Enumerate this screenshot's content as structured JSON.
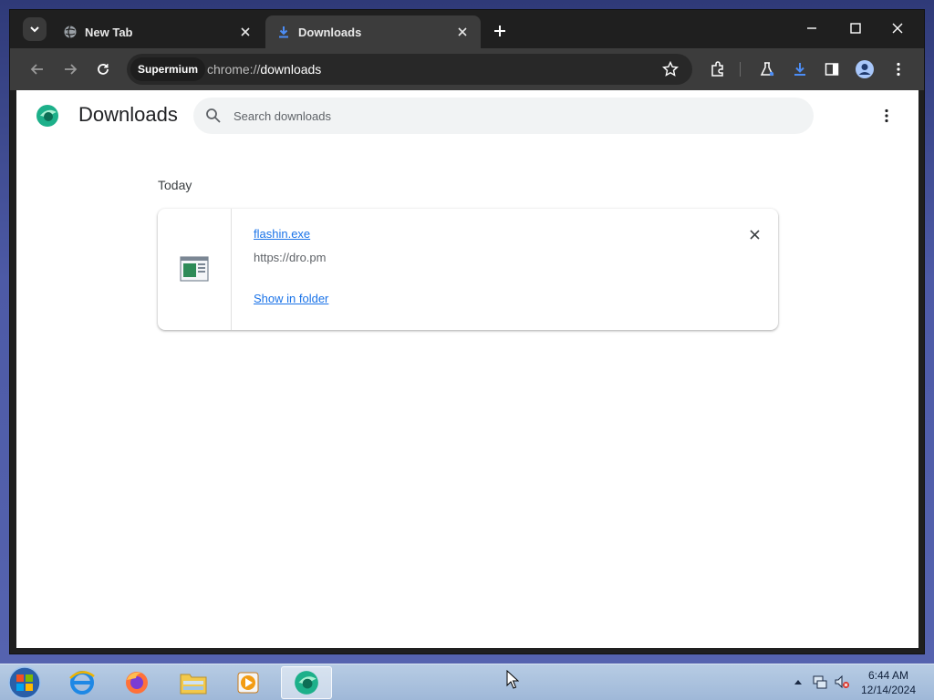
{
  "tabs": [
    {
      "label": "New Tab",
      "active": false,
      "icon": "globe-icon"
    },
    {
      "label": "Downloads",
      "active": true,
      "icon": "download-icon"
    }
  ],
  "toolbar": {
    "chip_label": "Supermium",
    "url_scheme": "chrome://",
    "url_host": "downloads"
  },
  "page": {
    "title": "Downloads",
    "search_placeholder": "Search downloads",
    "date_group": "Today",
    "downloads": [
      {
        "file_name": "flashin.exe",
        "source_url": "https://dro.pm",
        "action_label": "Show in folder"
      }
    ]
  },
  "taskbar": {
    "apps": [
      "internet-explorer-icon",
      "firefox-icon",
      "file-explorer-icon",
      "media-player-icon",
      "supermium-icon"
    ],
    "active_app": "supermium-icon",
    "time": "6:44 AM",
    "date": "12/14/2024"
  },
  "colors": {
    "link": "#1a73e8",
    "tab_active": "#3c3c3c",
    "toolbar": "#3c3c3c",
    "download_accent": "#4c8df6"
  }
}
